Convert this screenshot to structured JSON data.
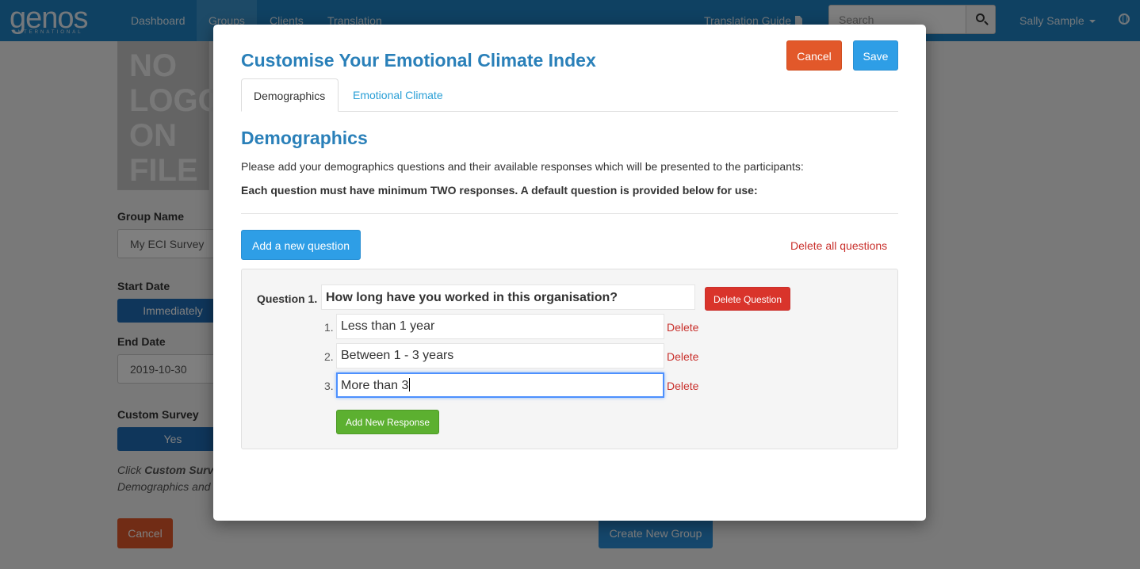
{
  "navbar": {
    "logo_text": "genos",
    "logo_subtext": "INTERNATIONAL",
    "items": [
      {
        "label": "Dashboard"
      },
      {
        "label": "Groups"
      },
      {
        "label": "Clients"
      },
      {
        "label": "Translation"
      }
    ],
    "translation_guide": "Translation Guide",
    "search_placeholder": "Search",
    "user_name": "Sally Sample"
  },
  "background_page": {
    "no_logo_text": "NO LOGO ON FILE",
    "group_name_label": "Group Name",
    "group_name_value": "My ECI Survey",
    "start_date_label": "Start Date",
    "start_date_value": "Immediately",
    "end_date_label": "End Date",
    "end_date_value": "2019-10-30",
    "custom_survey_label": "Custom Survey",
    "custom_survey_value": "Yes",
    "note_prefix": "Click ",
    "note_bold": "Custom Surv",
    "note_line2": "Demographics and",
    "cancel_label": "Cancel",
    "create_label": "Create New Group"
  },
  "modal": {
    "title": "Customise Your Emotional Climate Index",
    "cancel_label": "Cancel",
    "save_label": "Save",
    "tabs": [
      {
        "label": "Demographics"
      },
      {
        "label": "Emotional Climate"
      }
    ],
    "section_title": "Demographics",
    "intro": "Please add your demographics questions and their available responses which will be presented to the participants:",
    "intro_bold": "Each question must have minimum TWO responses. A default question is provided below for use:",
    "add_question_label": "Add a new question",
    "delete_all_label": "Delete all questions",
    "question": {
      "label": "Question 1.",
      "text": "How long have you worked in this organisation?",
      "delete_label": "Delete Question",
      "responses": [
        {
          "num": "1.",
          "text": "Less than 1 year",
          "delete": "Delete"
        },
        {
          "num": "2.",
          "text": "Between 1 - 3 years",
          "delete": "Delete"
        },
        {
          "num": "3.",
          "text": "More than 3",
          "delete": "Delete"
        }
      ],
      "add_response_label": "Add New Response"
    }
  },
  "colors": {
    "navbar": "#1f83c4",
    "title_blue": "#2a80b9",
    "primary_button": "#2e9ee6",
    "cancel_button": "#e2582a",
    "danger": "#d9342b",
    "success": "#5cb030"
  }
}
